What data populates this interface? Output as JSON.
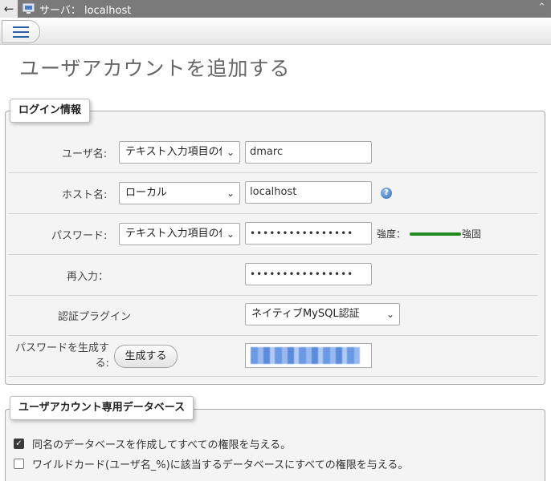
{
  "topbar": {
    "back_icon": "arrow-left-icon",
    "server_icon": "server-icon",
    "title": "サーバ： localhost",
    "collapse_icon": "double-chevron-up-icon"
  },
  "menu": {
    "icon": "hamburger-menu-icon"
  },
  "page_title": "ユーザアカウントを追加する",
  "login_info": {
    "legend": "ログイン情報",
    "username": {
      "label": "ユーザ名:",
      "select_value": "テキスト入力項目の値",
      "value": "dmarc"
    },
    "hostname": {
      "label": "ホスト名:",
      "select_value": "ローカル",
      "value": "localhost",
      "help_icon": "help-question-icon"
    },
    "password": {
      "label": "パスワード:",
      "select_value": "テキスト入力項目の値",
      "masked_value": "••••••••••••••••",
      "strength_label": "強度：",
      "strength_value": "強固",
      "strength_fraction": 1.0,
      "strength_color": "#1f8b1f"
    },
    "retype": {
      "label": "再入力：",
      "masked_value": "••••••••••••••••"
    },
    "auth_plugin": {
      "label": "認証プラグイン",
      "select_value": "ネイティブMySQL認証"
    },
    "generate": {
      "label_line1": "パスワードを生成す",
      "label_line2": "る:",
      "button": "生成する"
    }
  },
  "user_db": {
    "legend": "ユーザアカウント専用データベース",
    "options": [
      {
        "label": "同名のデータベースを作成してすべての権限を与える。",
        "checked": true
      },
      {
        "label": "ワイルドカード(ユーザ名_%)に該当するデータベースにすべての権限を与える。",
        "checked": false
      }
    ]
  },
  "colors": {
    "topbar_bg": "#7a7a7a",
    "accent_blue": "#2a5da8",
    "strength_green": "#1f8b1f"
  }
}
